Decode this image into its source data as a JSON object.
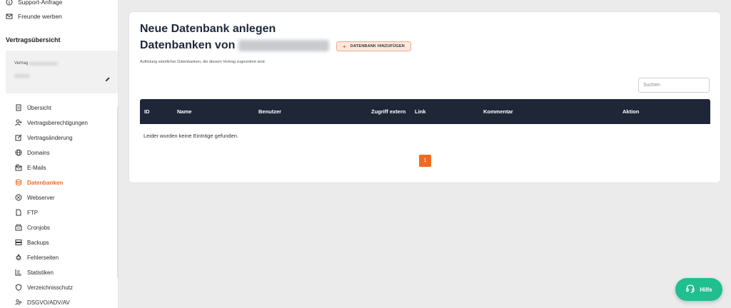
{
  "sidebar": {
    "top_links": [
      {
        "label": "Support-Anfrage",
        "icon": "info-icon"
      },
      {
        "label": "Freunde werben",
        "icon": "mail-icon"
      }
    ],
    "section_title": "Vertragsübersicht",
    "contract": {
      "label": "Vertrag"
    },
    "nav": [
      {
        "label": "Übersicht",
        "icon": "document-icon"
      },
      {
        "label": "Vertragsberechtigungen",
        "icon": "user-plus-icon"
      },
      {
        "label": "Vertragsänderung",
        "icon": "edit-icon"
      },
      {
        "label": "Domains",
        "icon": "globe-icon"
      },
      {
        "label": "E-Mails",
        "icon": "email-icon"
      },
      {
        "label": "Datenbanken",
        "icon": "database-icon",
        "active": true
      },
      {
        "label": "Webserver",
        "icon": "webserver-icon"
      },
      {
        "label": "FTP",
        "icon": "file-icon"
      },
      {
        "label": "Cronjobs",
        "icon": "cron-icon"
      },
      {
        "label": "Backups",
        "icon": "backup-icon"
      },
      {
        "label": "Fehlerseiten",
        "icon": "bug-icon"
      },
      {
        "label": "Statistiken",
        "icon": "chart-icon"
      },
      {
        "label": "Verzeichnisschutz",
        "icon": "shield-icon"
      },
      {
        "label": "DSGVO/ADV/AV",
        "icon": "users-icon"
      }
    ]
  },
  "main": {
    "title": "Neue Datenbank anlegen",
    "subtitle_prefix": "Datenbanken von",
    "add_button": "DATENBANK HINZUFÜGEN",
    "description": "Auflistung sämtlicher Datenbanken, die diesem Vertrag zugeordnet sind.",
    "search_placeholder": "Suchen",
    "table": {
      "columns": [
        "ID",
        "Name",
        "Benutzer",
        "Zugriff extern",
        "Link",
        "Kommentar",
        "Aktion"
      ],
      "empty_message": "Leider wurden keine Einträge gefunden."
    },
    "pagination": {
      "current_page": "1"
    }
  },
  "help_button": "Hilfe",
  "colors": {
    "accent": "#f26a21",
    "table_header": "#1e2638",
    "help": "#1fbf8f"
  }
}
